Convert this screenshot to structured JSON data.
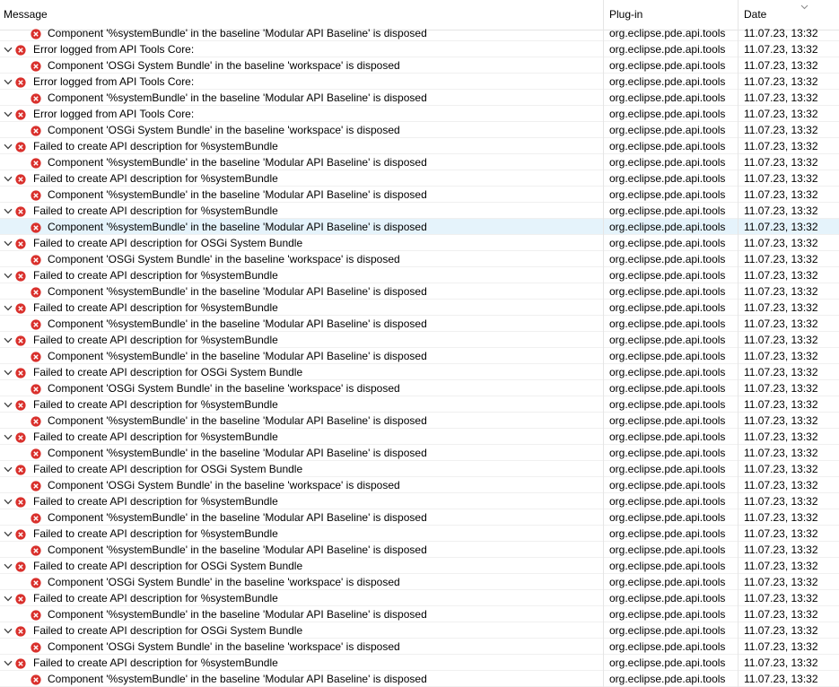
{
  "headers": {
    "message": "Message",
    "plugin": "Plug-in",
    "date": "Date"
  },
  "rows": [
    {
      "level": 1,
      "text": "Component '%systemBundle' in the baseline 'Modular API Baseline' is disposed",
      "plugin": "org.eclipse.pde.api.tools",
      "date": "11.07.23, 13:32"
    },
    {
      "level": 0,
      "text": "Error logged from API Tools Core:",
      "plugin": "org.eclipse.pde.api.tools",
      "date": "11.07.23, 13:32"
    },
    {
      "level": 1,
      "text": "Component 'OSGi System Bundle' in the baseline 'workspace' is disposed",
      "plugin": "org.eclipse.pde.api.tools",
      "date": "11.07.23, 13:32"
    },
    {
      "level": 0,
      "text": "Error logged from API Tools Core:",
      "plugin": "org.eclipse.pde.api.tools",
      "date": "11.07.23, 13:32"
    },
    {
      "level": 1,
      "text": "Component '%systemBundle' in the baseline 'Modular API Baseline' is disposed",
      "plugin": "org.eclipse.pde.api.tools",
      "date": "11.07.23, 13:32"
    },
    {
      "level": 0,
      "text": "Error logged from API Tools Core:",
      "plugin": "org.eclipse.pde.api.tools",
      "date": "11.07.23, 13:32"
    },
    {
      "level": 1,
      "text": "Component 'OSGi System Bundle' in the baseline 'workspace' is disposed",
      "plugin": "org.eclipse.pde.api.tools",
      "date": "11.07.23, 13:32"
    },
    {
      "level": 0,
      "text": "Failed to create API description for %systemBundle",
      "plugin": "org.eclipse.pde.api.tools",
      "date": "11.07.23, 13:32"
    },
    {
      "level": 1,
      "text": "Component '%systemBundle' in the baseline 'Modular API Baseline' is disposed",
      "plugin": "org.eclipse.pde.api.tools",
      "date": "11.07.23, 13:32"
    },
    {
      "level": 0,
      "text": "Failed to create API description for %systemBundle",
      "plugin": "org.eclipse.pde.api.tools",
      "date": "11.07.23, 13:32"
    },
    {
      "level": 1,
      "text": "Component '%systemBundle' in the baseline 'Modular API Baseline' is disposed",
      "plugin": "org.eclipse.pde.api.tools",
      "date": "11.07.23, 13:32"
    },
    {
      "level": 0,
      "text": "Failed to create API description for %systemBundle",
      "plugin": "org.eclipse.pde.api.tools",
      "date": "11.07.23, 13:32"
    },
    {
      "level": 1,
      "text": "Component '%systemBundle' in the baseline 'Modular API Baseline' is disposed",
      "plugin": "org.eclipse.pde.api.tools",
      "date": "11.07.23, 13:32",
      "selected": true
    },
    {
      "level": 0,
      "text": "Failed to create API description for OSGi System Bundle",
      "plugin": "org.eclipse.pde.api.tools",
      "date": "11.07.23, 13:32"
    },
    {
      "level": 1,
      "text": "Component 'OSGi System Bundle' in the baseline 'workspace' is disposed",
      "plugin": "org.eclipse.pde.api.tools",
      "date": "11.07.23, 13:32"
    },
    {
      "level": 0,
      "text": "Failed to create API description for %systemBundle",
      "plugin": "org.eclipse.pde.api.tools",
      "date": "11.07.23, 13:32"
    },
    {
      "level": 1,
      "text": "Component '%systemBundle' in the baseline 'Modular API Baseline' is disposed",
      "plugin": "org.eclipse.pde.api.tools",
      "date": "11.07.23, 13:32"
    },
    {
      "level": 0,
      "text": "Failed to create API description for %systemBundle",
      "plugin": "org.eclipse.pde.api.tools",
      "date": "11.07.23, 13:32"
    },
    {
      "level": 1,
      "text": "Component '%systemBundle' in the baseline 'Modular API Baseline' is disposed",
      "plugin": "org.eclipse.pde.api.tools",
      "date": "11.07.23, 13:32"
    },
    {
      "level": 0,
      "text": "Failed to create API description for %systemBundle",
      "plugin": "org.eclipse.pde.api.tools",
      "date": "11.07.23, 13:32"
    },
    {
      "level": 1,
      "text": "Component '%systemBundle' in the baseline 'Modular API Baseline' is disposed",
      "plugin": "org.eclipse.pde.api.tools",
      "date": "11.07.23, 13:32"
    },
    {
      "level": 0,
      "text": "Failed to create API description for OSGi System Bundle",
      "plugin": "org.eclipse.pde.api.tools",
      "date": "11.07.23, 13:32"
    },
    {
      "level": 1,
      "text": "Component 'OSGi System Bundle' in the baseline 'workspace' is disposed",
      "plugin": "org.eclipse.pde.api.tools",
      "date": "11.07.23, 13:32"
    },
    {
      "level": 0,
      "text": "Failed to create API description for %systemBundle",
      "plugin": "org.eclipse.pde.api.tools",
      "date": "11.07.23, 13:32"
    },
    {
      "level": 1,
      "text": "Component '%systemBundle' in the baseline 'Modular API Baseline' is disposed",
      "plugin": "org.eclipse.pde.api.tools",
      "date": "11.07.23, 13:32"
    },
    {
      "level": 0,
      "text": "Failed to create API description for %systemBundle",
      "plugin": "org.eclipse.pde.api.tools",
      "date": "11.07.23, 13:32"
    },
    {
      "level": 1,
      "text": "Component '%systemBundle' in the baseline 'Modular API Baseline' is disposed",
      "plugin": "org.eclipse.pde.api.tools",
      "date": "11.07.23, 13:32"
    },
    {
      "level": 0,
      "text": "Failed to create API description for OSGi System Bundle",
      "plugin": "org.eclipse.pde.api.tools",
      "date": "11.07.23, 13:32"
    },
    {
      "level": 1,
      "text": "Component 'OSGi System Bundle' in the baseline 'workspace' is disposed",
      "plugin": "org.eclipse.pde.api.tools",
      "date": "11.07.23, 13:32"
    },
    {
      "level": 0,
      "text": "Failed to create API description for %systemBundle",
      "plugin": "org.eclipse.pde.api.tools",
      "date": "11.07.23, 13:32"
    },
    {
      "level": 1,
      "text": "Component '%systemBundle' in the baseline 'Modular API Baseline' is disposed",
      "plugin": "org.eclipse.pde.api.tools",
      "date": "11.07.23, 13:32"
    },
    {
      "level": 0,
      "text": "Failed to create API description for %systemBundle",
      "plugin": "org.eclipse.pde.api.tools",
      "date": "11.07.23, 13:32"
    },
    {
      "level": 1,
      "text": "Component '%systemBundle' in the baseline 'Modular API Baseline' is disposed",
      "plugin": "org.eclipse.pde.api.tools",
      "date": "11.07.23, 13:32"
    },
    {
      "level": 0,
      "text": "Failed to create API description for OSGi System Bundle",
      "plugin": "org.eclipse.pde.api.tools",
      "date": "11.07.23, 13:32"
    },
    {
      "level": 1,
      "text": "Component 'OSGi System Bundle' in the baseline 'workspace' is disposed",
      "plugin": "org.eclipse.pde.api.tools",
      "date": "11.07.23, 13:32"
    },
    {
      "level": 0,
      "text": "Failed to create API description for %systemBundle",
      "plugin": "org.eclipse.pde.api.tools",
      "date": "11.07.23, 13:32"
    },
    {
      "level": 1,
      "text": "Component '%systemBundle' in the baseline 'Modular API Baseline' is disposed",
      "plugin": "org.eclipse.pde.api.tools",
      "date": "11.07.23, 13:32"
    },
    {
      "level": 0,
      "text": "Failed to create API description for OSGi System Bundle",
      "plugin": "org.eclipse.pde.api.tools",
      "date": "11.07.23, 13:32"
    },
    {
      "level": 1,
      "text": "Component 'OSGi System Bundle' in the baseline 'workspace' is disposed",
      "plugin": "org.eclipse.pde.api.tools",
      "date": "11.07.23, 13:32"
    },
    {
      "level": 0,
      "text": "Failed to create API description for %systemBundle",
      "plugin": "org.eclipse.pde.api.tools",
      "date": "11.07.23, 13:32"
    },
    {
      "level": 1,
      "text": "Component '%systemBundle' in the baseline 'Modular API Baseline' is disposed",
      "plugin": "org.eclipse.pde.api.tools",
      "date": "11.07.23, 13:32"
    }
  ],
  "icons": {
    "error": "error-icon",
    "expand": "chevron-down-icon",
    "sort": "sort-descending-icon"
  },
  "colors": {
    "error_red": "#d9302c",
    "selection": "#e5f3fb",
    "grid": "#f0f0f0"
  }
}
